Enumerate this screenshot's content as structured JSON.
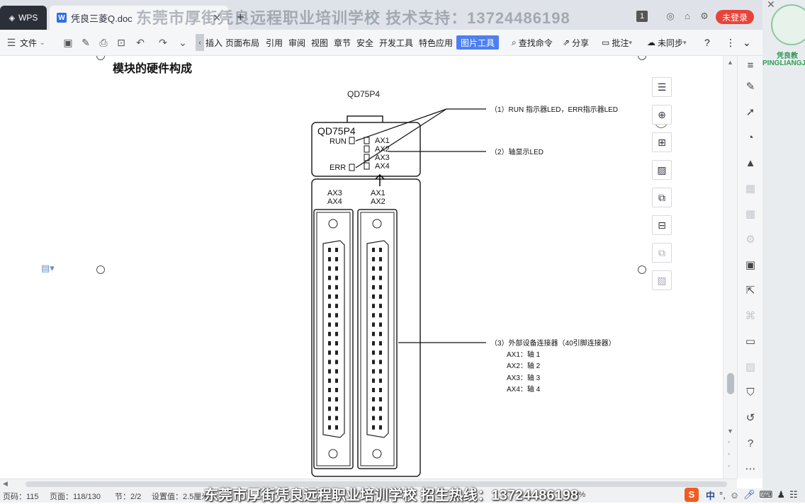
{
  "titlebar": {
    "wps_label": "WPS",
    "doc_tab_title": "凭良三菱Q.doc",
    "watermark": "东莞市厚街凭良远程职业培训学校 技术支持：13724486198",
    "page_badge": "1",
    "login_label": "未登录"
  },
  "ribbon": {
    "file_label": "文件",
    "tabs": [
      "插入",
      "页面布局",
      "引用",
      "审阅",
      "视图",
      "章节",
      "安全",
      "开发工具",
      "特色应用"
    ],
    "active_tab": "图片工具",
    "search_label": "查找命令",
    "share_label": "分享",
    "comment_label": "批注",
    "sync_label": "未同步",
    "help_label": "?"
  },
  "document": {
    "heading": "模块的硬件构成",
    "figure": {
      "model_caption": "QD75P4",
      "panel_title": "QD75P4",
      "run_label": "RUN",
      "err_label": "ERR",
      "led_labels": [
        "AX1",
        "AX2",
        "AX3",
        "AX4"
      ],
      "left_conn_labels": [
        "AX3",
        "AX4"
      ],
      "right_conn_labels": [
        "AX1",
        "AX2"
      ],
      "callout1": "（1）RUN 指示器LED，ERR指示器LED",
      "callout2": "（2）轴显示LED",
      "callout3": "（3）外部设备连接器（40引脚连接器）",
      "axis_map": [
        "AX1：轴 1",
        "AX2：轴 2",
        "AX3：轴 3",
        "AX4：轴 4"
      ]
    }
  },
  "status": {
    "row": "页码：115",
    "page": "页面：118/130",
    "section": "节：2/2",
    "setting": "设置值：2.5厘米",
    "zoom": "130%"
  },
  "bottom_watermark": "东莞市厚街凭良远程职业培训学校 招生热线：13724486198",
  "ime": {
    "lang": "中"
  },
  "logo": {
    "line1": "凭良教",
    "line2": "PINGLIANGJ"
  },
  "colors": {
    "accent": "#4c7ff0",
    "login": "#e8433a",
    "titlebar": "#dfe3e9"
  }
}
